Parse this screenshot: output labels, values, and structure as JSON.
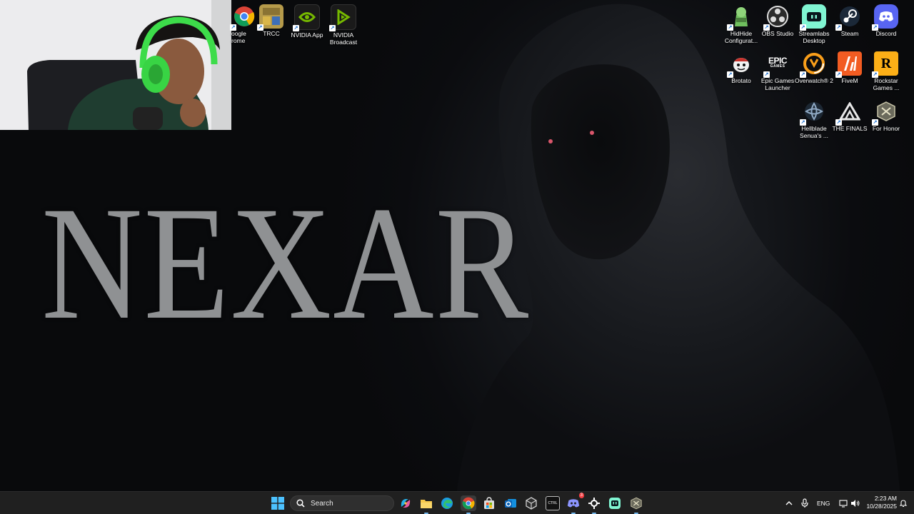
{
  "wallpaper": {
    "title": "NEXAR"
  },
  "desktop_icons": {
    "top_left": [
      {
        "label": "Google Chrome",
        "icon": "chrome-icon",
        "display": "oogle\nrome"
      },
      {
        "label": "TRCC",
        "icon": "trcc-icon"
      },
      {
        "label": "NVIDIA App",
        "icon": "nvidia-app-icon"
      },
      {
        "label": "NVIDIA Broadcast",
        "icon": "nvidia-broadcast-icon"
      }
    ],
    "top_right": [
      {
        "label": "HidHide Configurat...",
        "icon": "hidhide-icon"
      },
      {
        "label": "OBS Studio",
        "icon": "obs-icon"
      },
      {
        "label": "Streamlabs Desktop",
        "icon": "streamlabs-icon"
      },
      {
        "label": "Steam",
        "icon": "steam-icon"
      },
      {
        "label": "Discord",
        "icon": "discord-icon"
      },
      {
        "label": "Brotato",
        "icon": "brotato-icon"
      },
      {
        "label": "Epic Games Launcher",
        "icon": "epic-games-icon",
        "badge": "EPIC GAMES"
      },
      {
        "label": "Overwatch® 2",
        "icon": "overwatch-icon"
      },
      {
        "label": "FiveM",
        "icon": "fivem-icon"
      },
      {
        "label": "Rockstar Games ...",
        "icon": "rockstar-icon",
        "badge": "R"
      },
      {
        "label": "Hellblade Senua's ...",
        "icon": "hellblade-icon"
      },
      {
        "label": "THE FINALS",
        "icon": "the-finals-icon"
      },
      {
        "label": "For Honor",
        "icon": "for-honor-icon"
      }
    ]
  },
  "taskbar": {
    "search_placeholder": "Search",
    "apps": [
      "start-icon",
      "copilot-icon",
      "file-explorer-icon",
      "edge-icon",
      "chrome-icon",
      "store-icon",
      "outlook-icon",
      "unity-icon",
      "ctrl-app-icon",
      "discord-icon",
      "steelseries-icon",
      "streamlabs-icon",
      "for-honor-icon"
    ],
    "ctrl_badge": "CTRL",
    "discord_badge": "3",
    "tray": {
      "language": "ENG",
      "time": "2:23 AM",
      "date": "10/28/2025"
    }
  },
  "colors": {
    "taskbar": "#202020",
    "nvidia_green": "#76b900",
    "discord_blurple": "#5865f2",
    "streamlabs_teal": "#80f5d2"
  }
}
